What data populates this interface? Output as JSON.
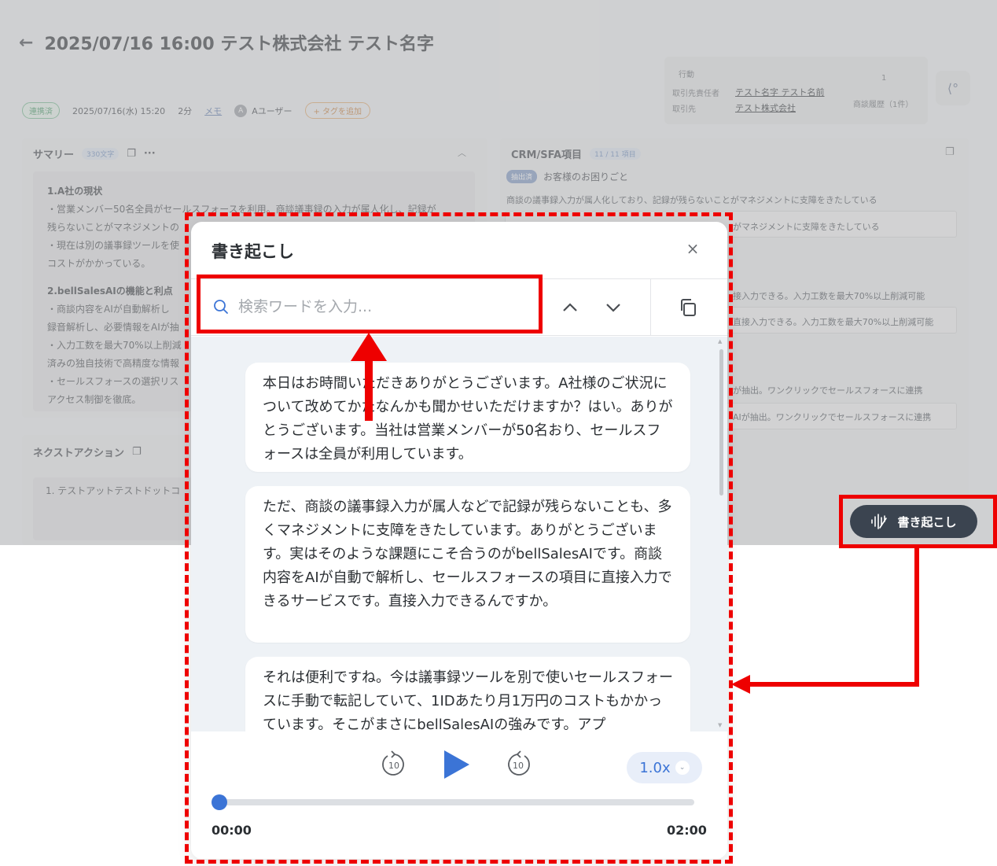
{
  "page": {
    "title": "2025/07/16 16:00 テスト株式会社 テスト名字",
    "status": "連携済",
    "datetime": "2025/07/16(水) 15:20",
    "duration": "2分",
    "memo": "メモ",
    "user_initial": "A",
    "user": "Aユーザー",
    "tag_button": "+ タグを追加",
    "info": {
      "action_label": "行動",
      "contact_label": "取引先責任者",
      "contact_value": "テスト名字 テスト名前",
      "account_label": "取引先",
      "account_value": "テスト株式会社",
      "history_count": "1",
      "history_label": "商談履歴（1件）"
    },
    "summary": {
      "title": "サマリー",
      "badge": "330文字",
      "h1": "1.A社の現状",
      "l1": "・営業メンバー50名全員がセールスフォースを利用。商談議事録の入力が属人化し、記録が",
      "l2": "残らないことがマネジメントの",
      "l3": "・現在は別の議事録ツールを使",
      "l4": "コストがかかっている。",
      "h2": "2.bellSalesAIの機能と利点",
      "l5": "・商談内容をAIが自動解析し",
      "l6": "録音解析し、必要情報をAIが抽",
      "l7": "・入力工数を最大70%以上削減",
      "l8": "済みの独自技術で高精度な情報",
      "l9": "・セールスフォースの選択リス",
      "l10": "アクセス制御を徹底。"
    },
    "next_action": {
      "title": "ネクストアクション",
      "item": "1. テストアットテストドットコ"
    },
    "crm": {
      "title": "CRM/SFA項目",
      "badge": "11 / 11 項目",
      "tag": "抽出済",
      "field": "お客様のお困りごと",
      "line1": "商談の議事録入力が属人化しており、記録が残らないことがマネジメントに支障をきたしている",
      "line2": "がマネジメントに支障をきたしている",
      "line3": "接入力できる。入力工数を最大70%以上削減可能",
      "line4": "直接入力できる。入力工数を最大70%以上削減可能",
      "line5": "が抽出。ワンクリックでセールスフォースに連携",
      "line6": "AIが抽出。ワンクリックでセールスフォースに連携"
    }
  },
  "transcript_modal": {
    "title": "書き起こし",
    "search_placeholder": "検索ワードを入力...",
    "messages": [
      "本日はお時間いただきありがとうございます。A社様のご状況について改めてかたなんかも聞かせいただけますか？はい。ありがとうございます。当社は営業メンバーが50名おり、セールスフォースは全員が利用しています。",
      "ただ、商談の議事録入力が属人などで記録が残らないことも、多くマネジメントに支障をきたしています。ありがとうございます。実はそのような課題にこそ合うのがbellSalesAIです。商談内容をAIが自動で解析し、セールスフォースの項目に直接入力できるサービスです。直接入力できるんですか。",
      "それは便利ですね。今は議事録ツールを別で使いセールスフォースに手動で転記していて、1IDあたり月1万円のコストもかかっています。そこがまさにbellSalesAIの強みです。アプ"
    ],
    "player": {
      "skip_back": "10",
      "skip_forward": "10",
      "speed": "1.0x",
      "current_time": "00:00",
      "total_time": "02:00",
      "progress": 0
    }
  },
  "float_button": {
    "label": "書き起こし"
  },
  "colors": {
    "accent": "#3b74d6",
    "annotation": "#ee0000",
    "float_button": "#3b4450"
  }
}
